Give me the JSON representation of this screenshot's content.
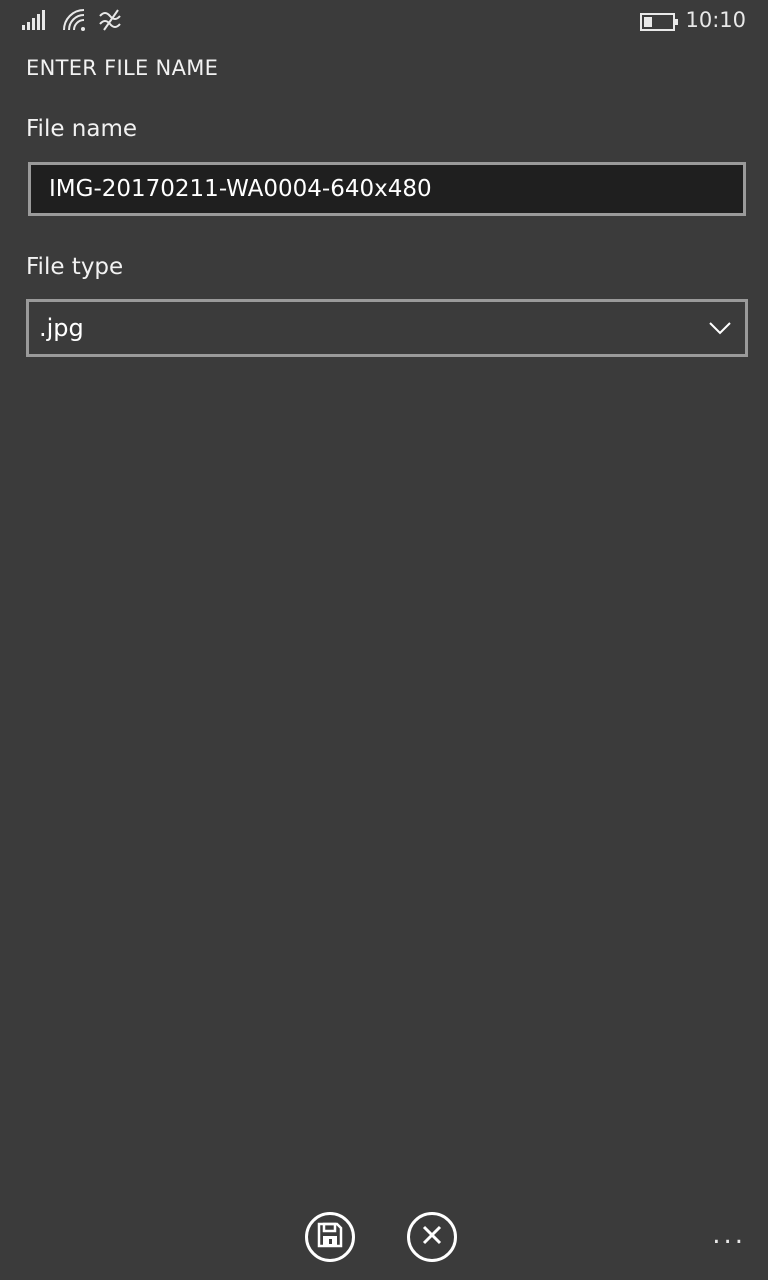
{
  "status_bar": {
    "time": "10:10",
    "icons": [
      "signal-bars-icon",
      "wifi-icon",
      "data-connection-icon",
      "battery-icon"
    ]
  },
  "page": {
    "title": "ENTER FILE NAME"
  },
  "form": {
    "file_name_label": "File name",
    "file_name_value": "IMG-20170211-WA0004-640x480",
    "file_type_label": "File type",
    "file_type_selected": ".jpg"
  },
  "app_bar": {
    "save_icon": "save-icon",
    "cancel_icon": "close-icon",
    "more_label": "..."
  },
  "colors": {
    "background": "#3b3b3b",
    "input_background": "#1f1f1f",
    "border": "#9a9a9a",
    "text": "#ffffff"
  }
}
